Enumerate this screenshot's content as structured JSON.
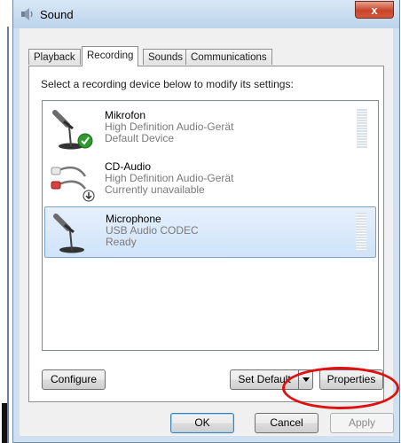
{
  "window": {
    "title": "Sound",
    "close_label": "x"
  },
  "tabs": [
    {
      "label": "Playback",
      "active": false
    },
    {
      "label": "Recording",
      "active": true
    },
    {
      "label": "Sounds",
      "active": false
    },
    {
      "label": "Communications",
      "active": false
    }
  ],
  "recording": {
    "instruction": "Select a recording device below to modify its settings:",
    "devices": [
      {
        "name": "Mikrofon",
        "description": "High Definition Audio-Gerät",
        "status": "Default Device",
        "icon": "microphone-default-icon",
        "selected": false
      },
      {
        "name": "CD-Audio",
        "description": "High Definition Audio-Gerät",
        "status": "Currently unavailable",
        "icon": "cd-audio-cable-icon",
        "selected": false
      },
      {
        "name": "Microphone",
        "description": "USB Audio CODEC",
        "status": "Ready",
        "icon": "microphone-icon",
        "selected": true
      }
    ],
    "configure_label": "Configure",
    "set_default_label": "Set Default",
    "properties_label": "Properties"
  },
  "footer": {
    "ok_label": "OK",
    "cancel_label": "Cancel",
    "apply_label": "Apply"
  },
  "colors": {
    "highlight_ring": "#e01010",
    "selection": "#cfe3fa",
    "accent": "#3c7fb1"
  }
}
